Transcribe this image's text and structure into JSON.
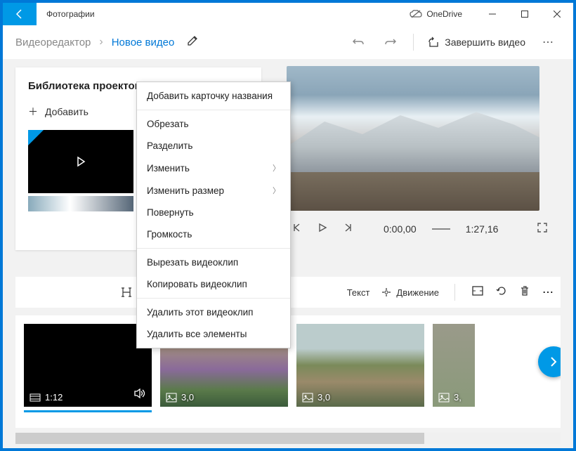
{
  "titlebar": {
    "app_name": "Фотографии",
    "onedrive": "OneDrive"
  },
  "breadcrumb": {
    "editor": "Видеоредактор",
    "project": "Новое видео"
  },
  "toolbar": {
    "finish": "Завершить видео"
  },
  "library": {
    "title": "Библиотека проектов",
    "add": "Добавить"
  },
  "player": {
    "time_current": "0:00,00",
    "time_total": "1:27,16"
  },
  "sb_toolbar": {
    "text": "Текст",
    "motion": "Движение"
  },
  "clips": [
    {
      "duration": "1:12"
    },
    {
      "duration": "3,0"
    },
    {
      "duration": "3,0"
    },
    {
      "duration": "3,"
    }
  ],
  "context_menu": {
    "add_title": "Добавить карточку названия",
    "trim": "Обрезать",
    "split": "Разделить",
    "edit": "Изменить",
    "resize": "Изменить размер",
    "rotate": "Повернуть",
    "volume": "Громкость",
    "cut": "Вырезать видеоклип",
    "copy": "Копировать видеоклип",
    "delete_clip": "Удалить этот видеоклип",
    "delete_all": "Удалить все элементы"
  }
}
